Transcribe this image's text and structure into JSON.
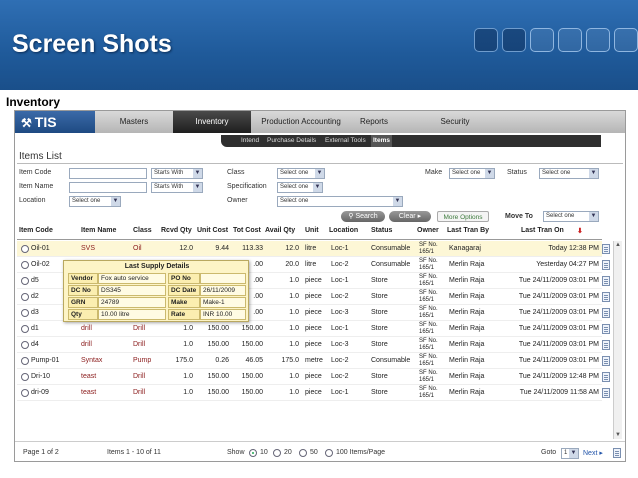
{
  "slide": {
    "title": "Screen Shots",
    "section": "Inventory"
  },
  "nav": {
    "logo": "TIS",
    "items": [
      "Masters",
      "Inventory",
      "Production Accounting",
      "Reports",
      "Security"
    ],
    "active": "Inventory",
    "subitems": [
      "Intend",
      "Purchase Details",
      "External Tools",
      "Items"
    ],
    "active_sub": "Items"
  },
  "page": {
    "title": "Items List"
  },
  "filters": {
    "item_code_label": "Item Code",
    "item_name_label": "Item Name",
    "location_label": "Location",
    "class_label": "Class",
    "specification_label": "Specification",
    "owner_label": "Owner",
    "make_label": "Make",
    "status_label": "Status",
    "starts_with": "Starts With",
    "select_one": "Select one",
    "search_btn": "Search",
    "clear_btn": "Clear",
    "more_options_btn": "More Options",
    "move_to_label": "Move To"
  },
  "table": {
    "headers": [
      "Item Code",
      "Item Name",
      "Class",
      "Rcvd Qty",
      "Unit Cost",
      "Tot Cost",
      "Avail Qty",
      "Unit",
      "Location",
      "Status",
      "Owner",
      "Last Tran By",
      "Last Tran On"
    ],
    "rows": [
      {
        "code": "Oil-01",
        "name": "SVS",
        "class": "Oil",
        "rcvd": "12.0",
        "unit_cost": "9.44",
        "tot_cost": "113.33",
        "avail": "12.0",
        "unit": "litre",
        "loc": "Loc-1",
        "status": "Consumable",
        "owner": "SF No. 165/1",
        "by": "Kanagaraj",
        "on": "Today 12:38 PM"
      },
      {
        "code": "Oil-02",
        "name": "",
        "class": "",
        "rcvd": "",
        "unit_cost": "",
        "tot_cost": ".00",
        "avail": "20.0",
        "unit": "litre",
        "loc": "Loc-2",
        "status": "Consumable",
        "owner": "SF No. 165/1",
        "by": "Merlin Raja",
        "on": "Yesterday 04:27 PM"
      },
      {
        "code": "d5",
        "name": "",
        "class": "",
        "rcvd": "",
        "unit_cost": "",
        "tot_cost": ".00",
        "avail": "1.0",
        "unit": "piece",
        "loc": "Loc-1",
        "status": "Store",
        "owner": "SF No. 165/1",
        "by": "Merlin Raja",
        "on": "Tue 24/11/2009 03:01 PM"
      },
      {
        "code": "d2",
        "name": "",
        "class": "",
        "rcvd": "",
        "unit_cost": "",
        "tot_cost": ".00",
        "avail": "1.0",
        "unit": "piece",
        "loc": "Loc-2",
        "status": "Store",
        "owner": "SF No. 165/1",
        "by": "Merlin Raja",
        "on": "Tue 24/11/2009 03:01 PM"
      },
      {
        "code": "d3",
        "name": "",
        "class": "",
        "rcvd": "",
        "unit_cost": "",
        "tot_cost": ".00",
        "avail": "1.0",
        "unit": "piece",
        "loc": "Loc-3",
        "status": "Store",
        "owner": "SF No. 165/1",
        "by": "Merlin Raja",
        "on": "Tue 24/11/2009 03:01 PM"
      },
      {
        "code": "d1",
        "name": "drill",
        "class": "Drill",
        "rcvd": "1.0",
        "unit_cost": "150.00",
        "tot_cost": "150.00",
        "avail": "1.0",
        "unit": "piece",
        "loc": "Loc-1",
        "status": "Store",
        "owner": "SF No. 165/1",
        "by": "Merlin Raja",
        "on": "Tue 24/11/2009 03:01 PM"
      },
      {
        "code": "d4",
        "name": "drill",
        "class": "Drill",
        "rcvd": "1.0",
        "unit_cost": "150.00",
        "tot_cost": "150.00",
        "avail": "1.0",
        "unit": "piece",
        "loc": "Loc-3",
        "status": "Store",
        "owner": "SF No. 165/1",
        "by": "Merlin Raja",
        "on": "Tue 24/11/2009 03:01 PM"
      },
      {
        "code": "Pump-01",
        "name": "Syntax",
        "class": "Pump",
        "rcvd": "175.0",
        "unit_cost": "0.26",
        "tot_cost": "46.05",
        "avail": "175.0",
        "unit": "metre",
        "loc": "Loc-2",
        "status": "Consumable",
        "owner": "SF No. 165/1",
        "by": "Merlin Raja",
        "on": "Tue 24/11/2009 03:01 PM"
      },
      {
        "code": "Dri-10",
        "name": "teast",
        "class": "Drill",
        "rcvd": "1.0",
        "unit_cost": "150.00",
        "tot_cost": "150.00",
        "avail": "1.0",
        "unit": "piece",
        "loc": "Loc-2",
        "status": "Store",
        "owner": "SF No. 165/1",
        "by": "Merlin Raja",
        "on": "Tue 24/11/2009 12:48 PM"
      },
      {
        "code": "dri-09",
        "name": "teast",
        "class": "Drill",
        "rcvd": "1.0",
        "unit_cost": "150.00",
        "tot_cost": "150.00",
        "avail": "1.0",
        "unit": "piece",
        "loc": "Loc-1",
        "status": "Store",
        "owner": "SF No. 165/1",
        "by": "Merlin Raja",
        "on": "Tue 24/11/2009 11:58 AM"
      }
    ]
  },
  "popup": {
    "title": "Last Supply Details",
    "vendor_label": "Vendor",
    "vendor": "Fox auto service",
    "po_label": "PO No",
    "po": "",
    "dc_label": "DC No",
    "dc": "DS345",
    "dc_date_label": "DC Date",
    "dc_date": "26/11/2009",
    "grn_label": "GRN",
    "grn": "24789",
    "make_label": "Make",
    "make": "Make-1",
    "qty_label": "Qty",
    "qty": "10.00 litre",
    "rate_label": "Rate",
    "rate": "INR 10.00"
  },
  "footer": {
    "page_info": "Page 1 of 2",
    "items_info": "Items 1 - 10 of 11",
    "show_label": "Show",
    "opt_10": "10",
    "opt_20": "20",
    "opt_50": "50",
    "opt_100": "100 Items/Page",
    "goto_label": "Goto",
    "goto_value": "1",
    "next_label": "Next ▸"
  },
  "colors": {
    "header_blue": "#1f5a9a",
    "highlight_row": "#fdf7d6",
    "popup_bg": "#fdf4c6"
  }
}
